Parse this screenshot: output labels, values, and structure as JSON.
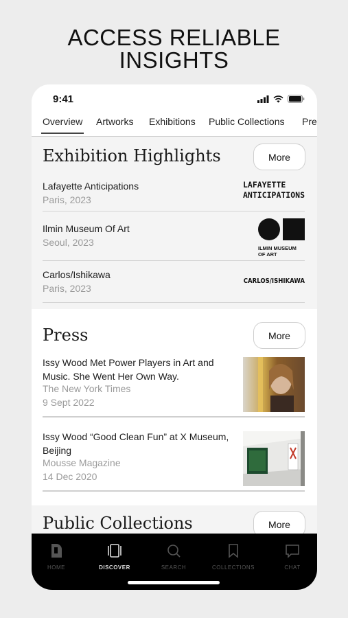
{
  "headline": {
    "line1": "ACCESS RELIABLE",
    "line2": "INSIGHTS"
  },
  "status": {
    "time": "9:41"
  },
  "tabs": [
    "Overview",
    "Artworks",
    "Exhibitions",
    "Public Collections",
    "Pre"
  ],
  "exhibitions": {
    "title": "Exhibition Highlights",
    "more": "More",
    "items": [
      {
        "name": "Lafayette Anticipations",
        "meta": "Paris, 2023",
        "logo_line1": "LAFAYETTE",
        "logo_line2": "ANTICIPATIONS"
      },
      {
        "name": "Ilmin Museum Of Art",
        "meta": "Seoul, 2023",
        "logo_line1": "ILMIN MUSEUM",
        "logo_line2": "OF ART"
      },
      {
        "name": "Carlos/Ishikawa",
        "meta": "Paris, 2023",
        "logo_line1": "CARLOS/ISHIKAWA"
      }
    ]
  },
  "press": {
    "title": "Press",
    "more": "More",
    "items": [
      {
        "title": "Issy Wood Met Power Players in Art and Music. She Went Her Own Way.",
        "source": "The New York Times",
        "date": "9 Sept 2022"
      },
      {
        "title": "Issy Wood “Good Clean Fun” at X Museum, Beijing",
        "source": "Mousse Magazine",
        "date": "14 Dec 2020"
      }
    ]
  },
  "collections": {
    "title": "Public Collections",
    "more": "More"
  },
  "nav": [
    {
      "label": "HOME",
      "icon": "home-icon"
    },
    {
      "label": "DISCOVER",
      "icon": "discover-icon",
      "active": true
    },
    {
      "label": "SEARCH",
      "icon": "search-icon"
    },
    {
      "label": "COLLECTIONS",
      "icon": "bookmark-icon"
    },
    {
      "label": "CHAT",
      "icon": "chat-icon"
    }
  ],
  "colors": {
    "background": "#ededed",
    "nav_bg": "#000000",
    "card_bg": "#f4f4f4"
  }
}
